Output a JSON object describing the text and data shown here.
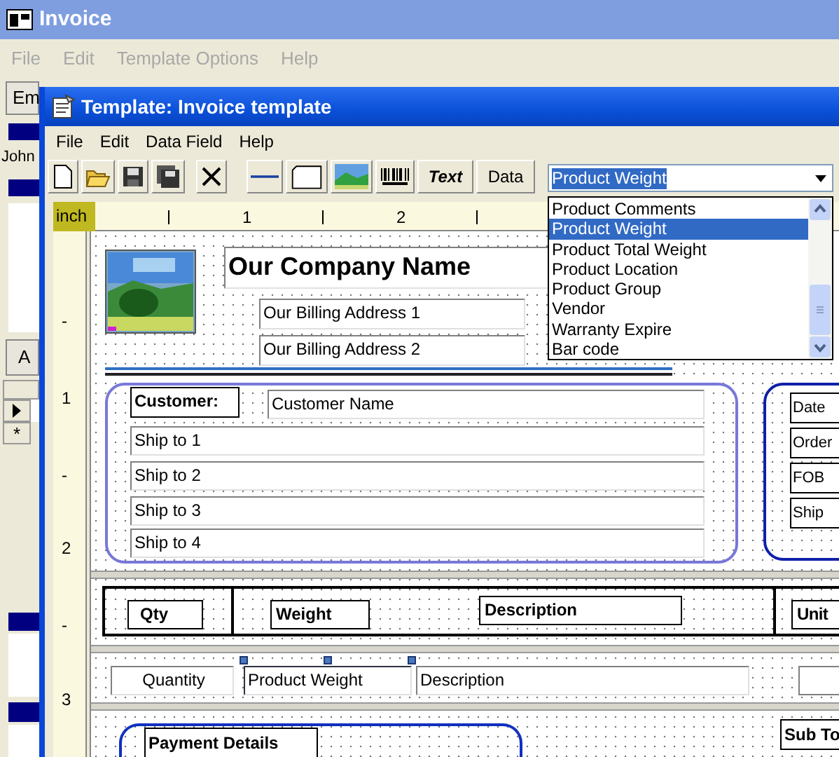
{
  "background_window": {
    "title": "Invoice",
    "menu": [
      "File",
      "Edit",
      "Template Options",
      "Help"
    ],
    "button_1": "Em",
    "list_text": "John",
    "button_2": "A",
    "grid_rows": [
      {
        "kind": "current"
      },
      {
        "kind": "new",
        "marker": "*"
      }
    ]
  },
  "template_window": {
    "title": "Template: Invoice template",
    "menu": [
      "File",
      "Edit",
      "Data Field",
      "Help"
    ],
    "toolbar_text_buttons": [
      "Text",
      "Data"
    ],
    "field_combo": {
      "value": "Product Weight",
      "expanded": true,
      "items": [
        {
          "label": "Product Comments",
          "selected": false
        },
        {
          "label": "Product Weight",
          "selected": true
        },
        {
          "label": "Product Total Weight",
          "selected": false
        },
        {
          "label": "Product Location",
          "selected": false
        },
        {
          "label": "Product Group",
          "selected": false
        },
        {
          "label": "Vendor",
          "selected": false
        },
        {
          "label": "Warranty Expire",
          "selected": false
        },
        {
          "label": "Bar code",
          "selected": false
        }
      ]
    },
    "ruler": {
      "unit": "inch",
      "marks": [
        "1",
        "2"
      ],
      "vertical_marks": [
        "-",
        "1",
        "-",
        "2",
        "-",
        "3"
      ]
    },
    "canvas": {
      "company_name": "Our Company Name",
      "billing_addresses": [
        "Our Billing Address 1",
        "Our Billing Address 2"
      ],
      "customer_label": "Customer:",
      "customer_name": "Customer Name",
      "ship_to": [
        "Ship to 1",
        "Ship to 2",
        "Ship to 3",
        "Ship to 4"
      ],
      "info_labels": [
        "Date",
        "Order",
        "FOB",
        "Ship"
      ],
      "header_columns": [
        "Qty",
        "Weight",
        "Description",
        "Unit"
      ],
      "detail_fields": [
        {
          "label": "Quantity",
          "selected": false
        },
        {
          "label": "Product Weight",
          "selected": true
        },
        {
          "label": "Description",
          "selected": false
        }
      ],
      "payment_label": "Payment Details",
      "subtotal_label": "Sub To"
    }
  }
}
